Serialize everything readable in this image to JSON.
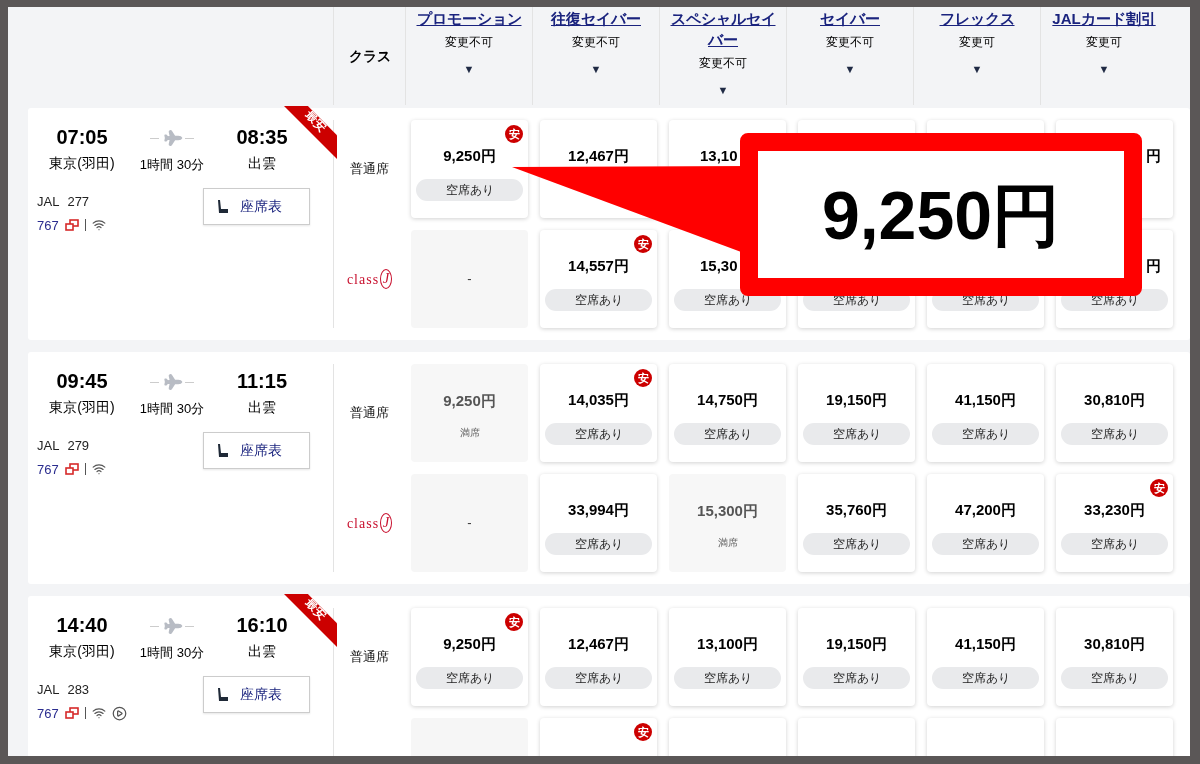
{
  "header": {
    "class_label": "クラス",
    "columns": [
      {
        "name": "プロモーション",
        "rule": "変更不可",
        "arrow": "▼"
      },
      {
        "name": "往復セイバー",
        "rule": "変更不可",
        "arrow": "▼"
      },
      {
        "name": "スペシャルセイバー",
        "rule": "変更不可",
        "arrow": "▼"
      },
      {
        "name": "セイバー",
        "rule": "変更不可",
        "arrow": "▼"
      },
      {
        "name": "フレックス",
        "rule": "変更可",
        "arrow": "▼"
      },
      {
        "name": "JALカード割引",
        "rule": "変更可",
        "arrow": "▼"
      }
    ]
  },
  "flights": [
    {
      "dep_time": "07:05",
      "dep_airport": "東京(羽田)",
      "duration": "1時間 30分",
      "arr_time": "08:35",
      "arr_airport": "出雲",
      "airline": "JAL",
      "number": "277",
      "aircraft": "767",
      "video": false,
      "ribbon": "最安",
      "seat_map": "座席表",
      "rows": [
        {
          "kind": "standard",
          "label": "普通席",
          "cells": [
            {
              "kind": "available",
              "fare": "9,250円",
              "status": "空席あり",
              "badge": "安"
            },
            {
              "kind": "available",
              "fare": "12,467円"
            },
            {
              "kind": "underlay",
              "fare": "13,10"
            },
            {
              "kind": "available"
            },
            {
              "kind": "available"
            },
            {
              "kind": "edge",
              "fare": "円"
            }
          ]
        },
        {
          "kind": "classj",
          "label": "class",
          "mark": "J",
          "cells": [
            {
              "kind": "none",
              "fare": "-"
            },
            {
              "kind": "available",
              "fare": "14,557円",
              "status": "空席あり",
              "badge": "安"
            },
            {
              "kind": "underlay",
              "fare": "15,30",
              "status": "空席あり"
            },
            {
              "kind": "available",
              "status": "空席あり"
            },
            {
              "kind": "available",
              "status": "空席あり"
            },
            {
              "kind": "edge",
              "fare": "円",
              "status": "空席あり"
            }
          ]
        }
      ]
    },
    {
      "dep_time": "09:45",
      "dep_airport": "東京(羽田)",
      "duration": "1時間 30分",
      "arr_time": "11:15",
      "arr_airport": "出雲",
      "airline": "JAL",
      "number": "279",
      "aircraft": "767",
      "video": false,
      "seat_map": "座席表",
      "rows": [
        {
          "kind": "standard",
          "label": "普通席",
          "cells": [
            {
              "kind": "full",
              "fare": "9,250円",
              "status": "満席"
            },
            {
              "kind": "available",
              "fare": "14,035円",
              "status": "空席あり",
              "badge": "安"
            },
            {
              "kind": "available",
              "fare": "14,750円",
              "status": "空席あり"
            },
            {
              "kind": "available",
              "fare": "19,150円",
              "status": "空席あり"
            },
            {
              "kind": "available",
              "fare": "41,150円",
              "status": "空席あり"
            },
            {
              "kind": "available",
              "fare": "30,810円",
              "status": "空席あり"
            }
          ]
        },
        {
          "kind": "classj",
          "label": "class",
          "mark": "J",
          "cells": [
            {
              "kind": "none",
              "fare": "-"
            },
            {
              "kind": "available",
              "fare": "33,994円",
              "status": "空席あり"
            },
            {
              "kind": "full",
              "fare": "15,300円",
              "status": "満席"
            },
            {
              "kind": "available",
              "fare": "35,760円",
              "status": "空席あり"
            },
            {
              "kind": "available",
              "fare": "47,200円",
              "status": "空席あり"
            },
            {
              "kind": "available",
              "fare": "33,230円",
              "status": "空席あり",
              "badge": "安"
            }
          ]
        }
      ]
    },
    {
      "dep_time": "14:40",
      "dep_airport": "東京(羽田)",
      "duration": "1時間 30分",
      "arr_time": "16:10",
      "arr_airport": "出雲",
      "airline": "JAL",
      "number": "283",
      "aircraft": "767",
      "video": true,
      "ribbon": "最安",
      "seat_map": "座席表",
      "rows": [
        {
          "kind": "standard",
          "label": "普通席",
          "cells": [
            {
              "kind": "available",
              "fare": "9,250円",
              "status": "空席あり",
              "badge": "安"
            },
            {
              "kind": "available",
              "fare": "12,467円",
              "status": "空席あり"
            },
            {
              "kind": "available",
              "fare": "13,100円",
              "status": "空席あり"
            },
            {
              "kind": "available",
              "fare": "19,150円",
              "status": "空席あり"
            },
            {
              "kind": "available",
              "fare": "41,150円",
              "status": "空席あり"
            },
            {
              "kind": "available",
              "fare": "30,810円",
              "status": "空席あり"
            }
          ]
        },
        {
          "kind": "classj",
          "cells": [
            {
              "kind": "none"
            },
            {
              "kind": "available",
              "badge": "安"
            },
            {
              "kind": "available"
            },
            {
              "kind": "available"
            },
            {
              "kind": "available"
            },
            {
              "kind": "available"
            }
          ]
        }
      ]
    }
  ],
  "callout": {
    "text": "9,250円"
  }
}
